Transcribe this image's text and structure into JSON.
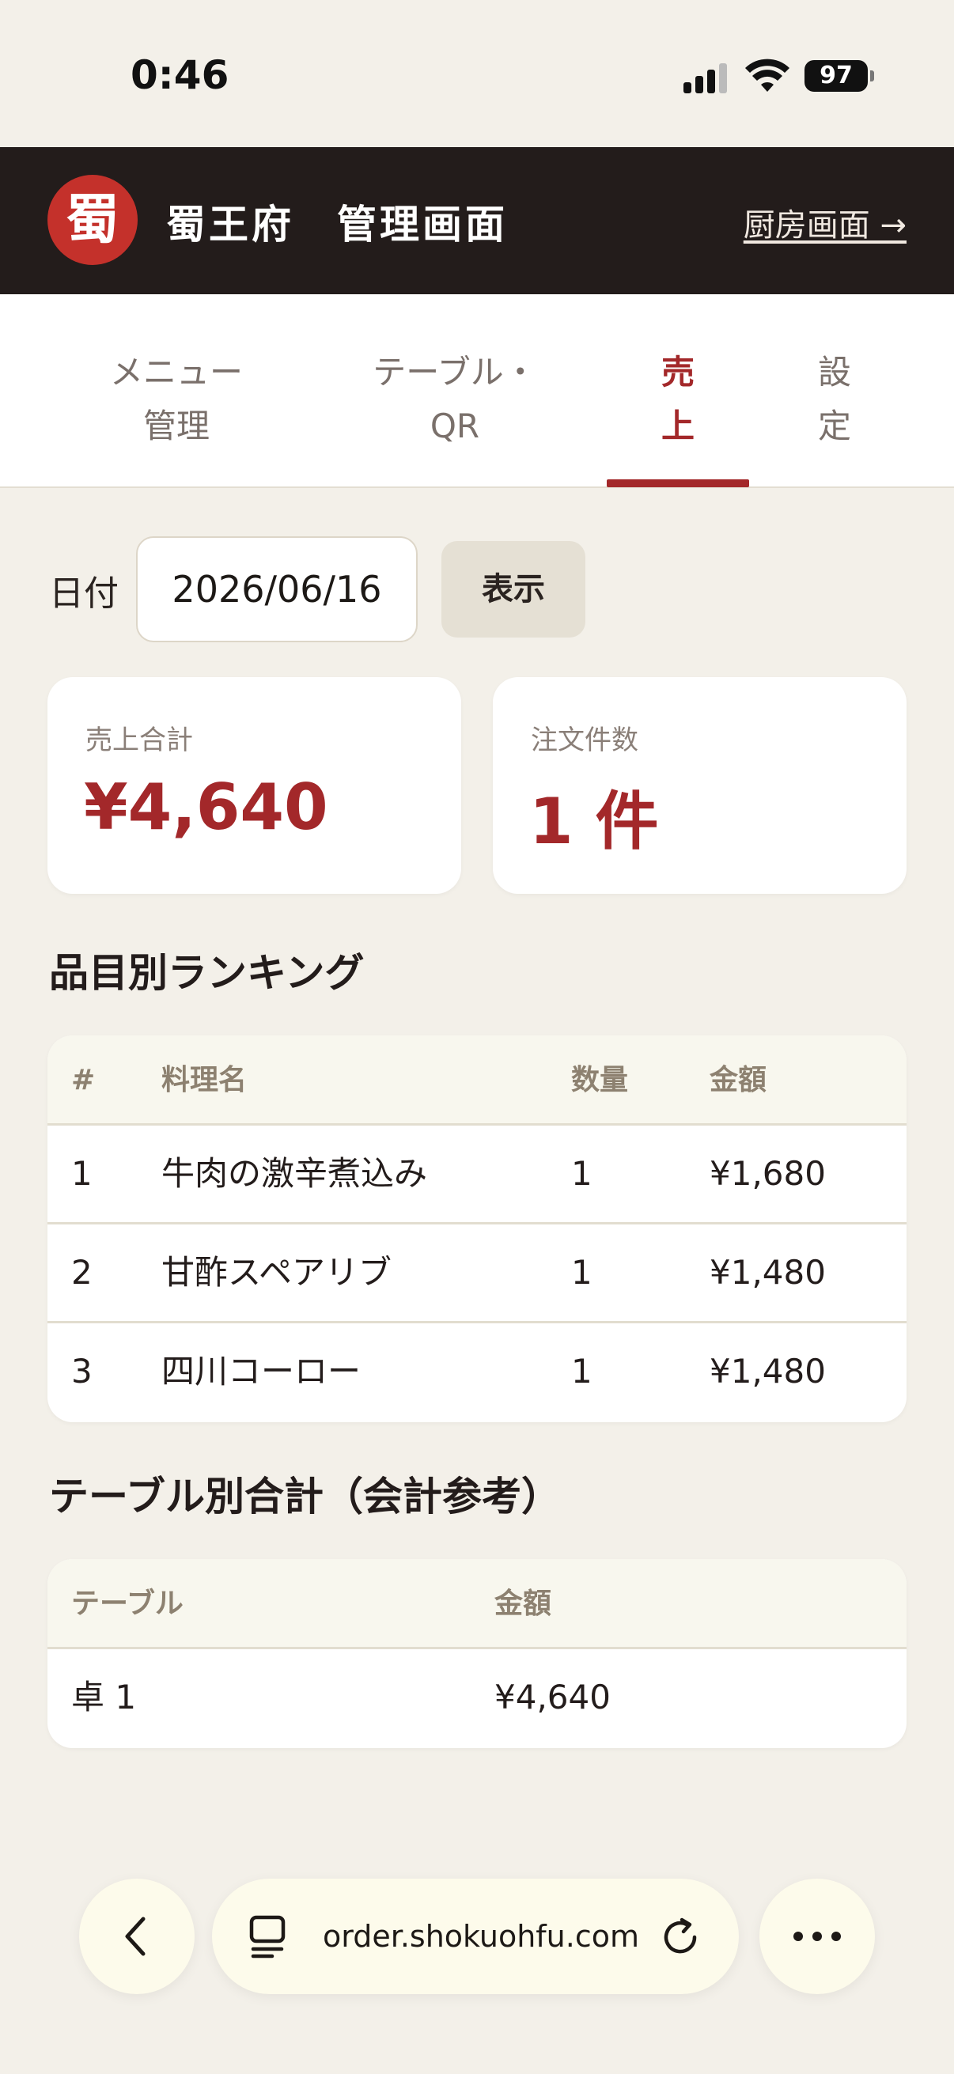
{
  "status_bar": {
    "time": "0:46",
    "battery": "97"
  },
  "header": {
    "logo_char": "蜀",
    "title": "蜀王府　管理画面",
    "kitchen_link": "厨房画面 →"
  },
  "tabs": [
    {
      "line1": "メニュー",
      "line2": "管理",
      "active": false
    },
    {
      "line1": "テーブル・",
      "line2": "QR",
      "active": false
    },
    {
      "line1": "売",
      "line2": "上",
      "active": true
    },
    {
      "line1": "設",
      "line2": "定",
      "active": false
    }
  ],
  "date_filter": {
    "label": "日付",
    "value": "2026/06/16",
    "button": "表示"
  },
  "summary": {
    "sales_label": "売上合計",
    "sales_value": "¥4,640",
    "orders_label": "注文件数",
    "orders_value": "1 件"
  },
  "ranking": {
    "title": "品目別ランキング",
    "headers": [
      "#",
      "料理名",
      "数量",
      "金額"
    ],
    "rows": [
      [
        "1",
        "牛肉の激辛煮込み",
        "1",
        "¥1,680"
      ],
      [
        "2",
        "甘酢スペアリブ",
        "1",
        "¥1,480"
      ],
      [
        "3",
        "四川コーロー",
        "1",
        "¥1,480"
      ]
    ]
  },
  "table_totals": {
    "title": "テーブル別合計（会計参考）",
    "headers": [
      "テーブル",
      "金額"
    ],
    "rows": [
      [
        "卓 1",
        "¥4,640"
      ]
    ]
  },
  "browser": {
    "url": "order.shokuohfu.com"
  },
  "colors": {
    "accent": "#a3282a",
    "header_bg": "#231c1b",
    "page_bg": "#f3f0e9",
    "logo": "#c4312b"
  }
}
